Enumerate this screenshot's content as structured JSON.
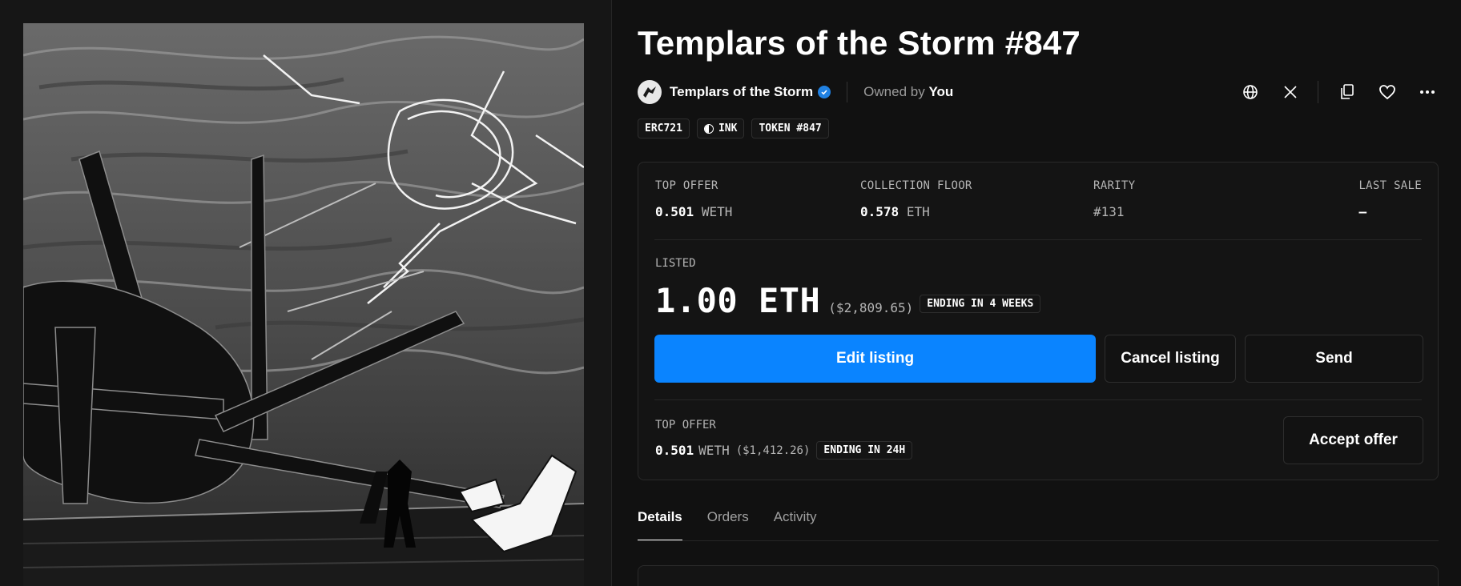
{
  "asset": {
    "title": "Templars of the Storm #847",
    "collection_name": "Templars of the Storm",
    "owned_prefix": "Owned by",
    "owner": "You",
    "tags": {
      "standard": "ERC721",
      "chain": "INK",
      "token": "TOKEN #847"
    }
  },
  "icons": {
    "website": "globe-icon",
    "social": "x-icon",
    "copy": "copy-icon",
    "favorite": "heart-icon",
    "more": "more-icon",
    "verified": "verified-badge-icon"
  },
  "stats": {
    "top_offer": {
      "label": "TOP OFFER",
      "value": "0.501",
      "unit": "WETH"
    },
    "collection_floor": {
      "label": "COLLECTION FLOOR",
      "value": "0.578",
      "unit": "ETH"
    },
    "rarity": {
      "label": "RARITY",
      "value": "#131"
    },
    "last_sale": {
      "label": "LAST SALE",
      "value": "–"
    }
  },
  "listing": {
    "label": "LISTED",
    "price": "1.00 ETH",
    "price_usd": "($2,809.65)",
    "ending": "ENDING IN 4 WEEKS",
    "edit_label": "Edit listing",
    "cancel_label": "Cancel listing",
    "send_label": "Send"
  },
  "offer": {
    "label": "TOP OFFER",
    "value": "0.501",
    "unit": "WETH",
    "usd": "($1,412.26)",
    "ending": "ENDING IN 24H",
    "accept_label": "Accept offer"
  },
  "tabs": [
    {
      "label": "Details",
      "active": true
    },
    {
      "label": "Orders",
      "active": false
    },
    {
      "label": "Activity",
      "active": false
    }
  ],
  "colors": {
    "accent": "#0a84ff",
    "background": "#111111",
    "verified": "#2081e2"
  }
}
